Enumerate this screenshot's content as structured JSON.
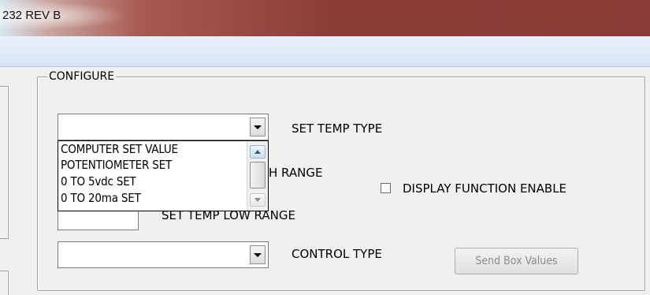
{
  "window": {
    "title": "232 REV B"
  },
  "group": {
    "legend": "CONFIGURE"
  },
  "set_temp_type": {
    "label": "SET TEMP TYPE",
    "value": ""
  },
  "dropdown_options": [
    "COMPUTER SET VALUE",
    "POTENTIOMETER SET",
    "0 TO 5vdc SET",
    "0 TO 20ma SET"
  ],
  "high_range": {
    "label_visible_part": "H RANGE"
  },
  "low_range": {
    "label": "SET TEMP LOW RANGE"
  },
  "display_function": {
    "label": "DISPLAY FUNCTION ENABLE",
    "checked": false
  },
  "control_type": {
    "label": "CONTROL TYPE",
    "value": ""
  },
  "send_button": {
    "label": "Send Box Values",
    "enabled": false
  }
}
